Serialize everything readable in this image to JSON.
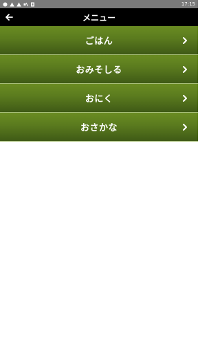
{
  "status_bar": {
    "time": "17:15",
    "icons": [
      "notification-dot-icon",
      "warning-icon",
      "alert-icon",
      "muted-icon",
      "sim-icon"
    ]
  },
  "app_bar": {
    "title": "メニュー",
    "back_icon": "arrow-left-icon"
  },
  "menu": {
    "items": [
      {
        "label": "ごはん",
        "icon": "chevron-right-icon"
      },
      {
        "label": "おみそしる",
        "icon": "chevron-right-icon"
      },
      {
        "label": "おにく",
        "icon": "chevron-right-icon"
      },
      {
        "label": "おさかな",
        "icon": "chevron-right-icon"
      }
    ]
  },
  "colors": {
    "menu_bg_top": "#6a8c22",
    "menu_bg_bottom": "#3f5a16",
    "app_bar_bg": "#000000",
    "status_bar_bg": "#7a7a7a"
  }
}
